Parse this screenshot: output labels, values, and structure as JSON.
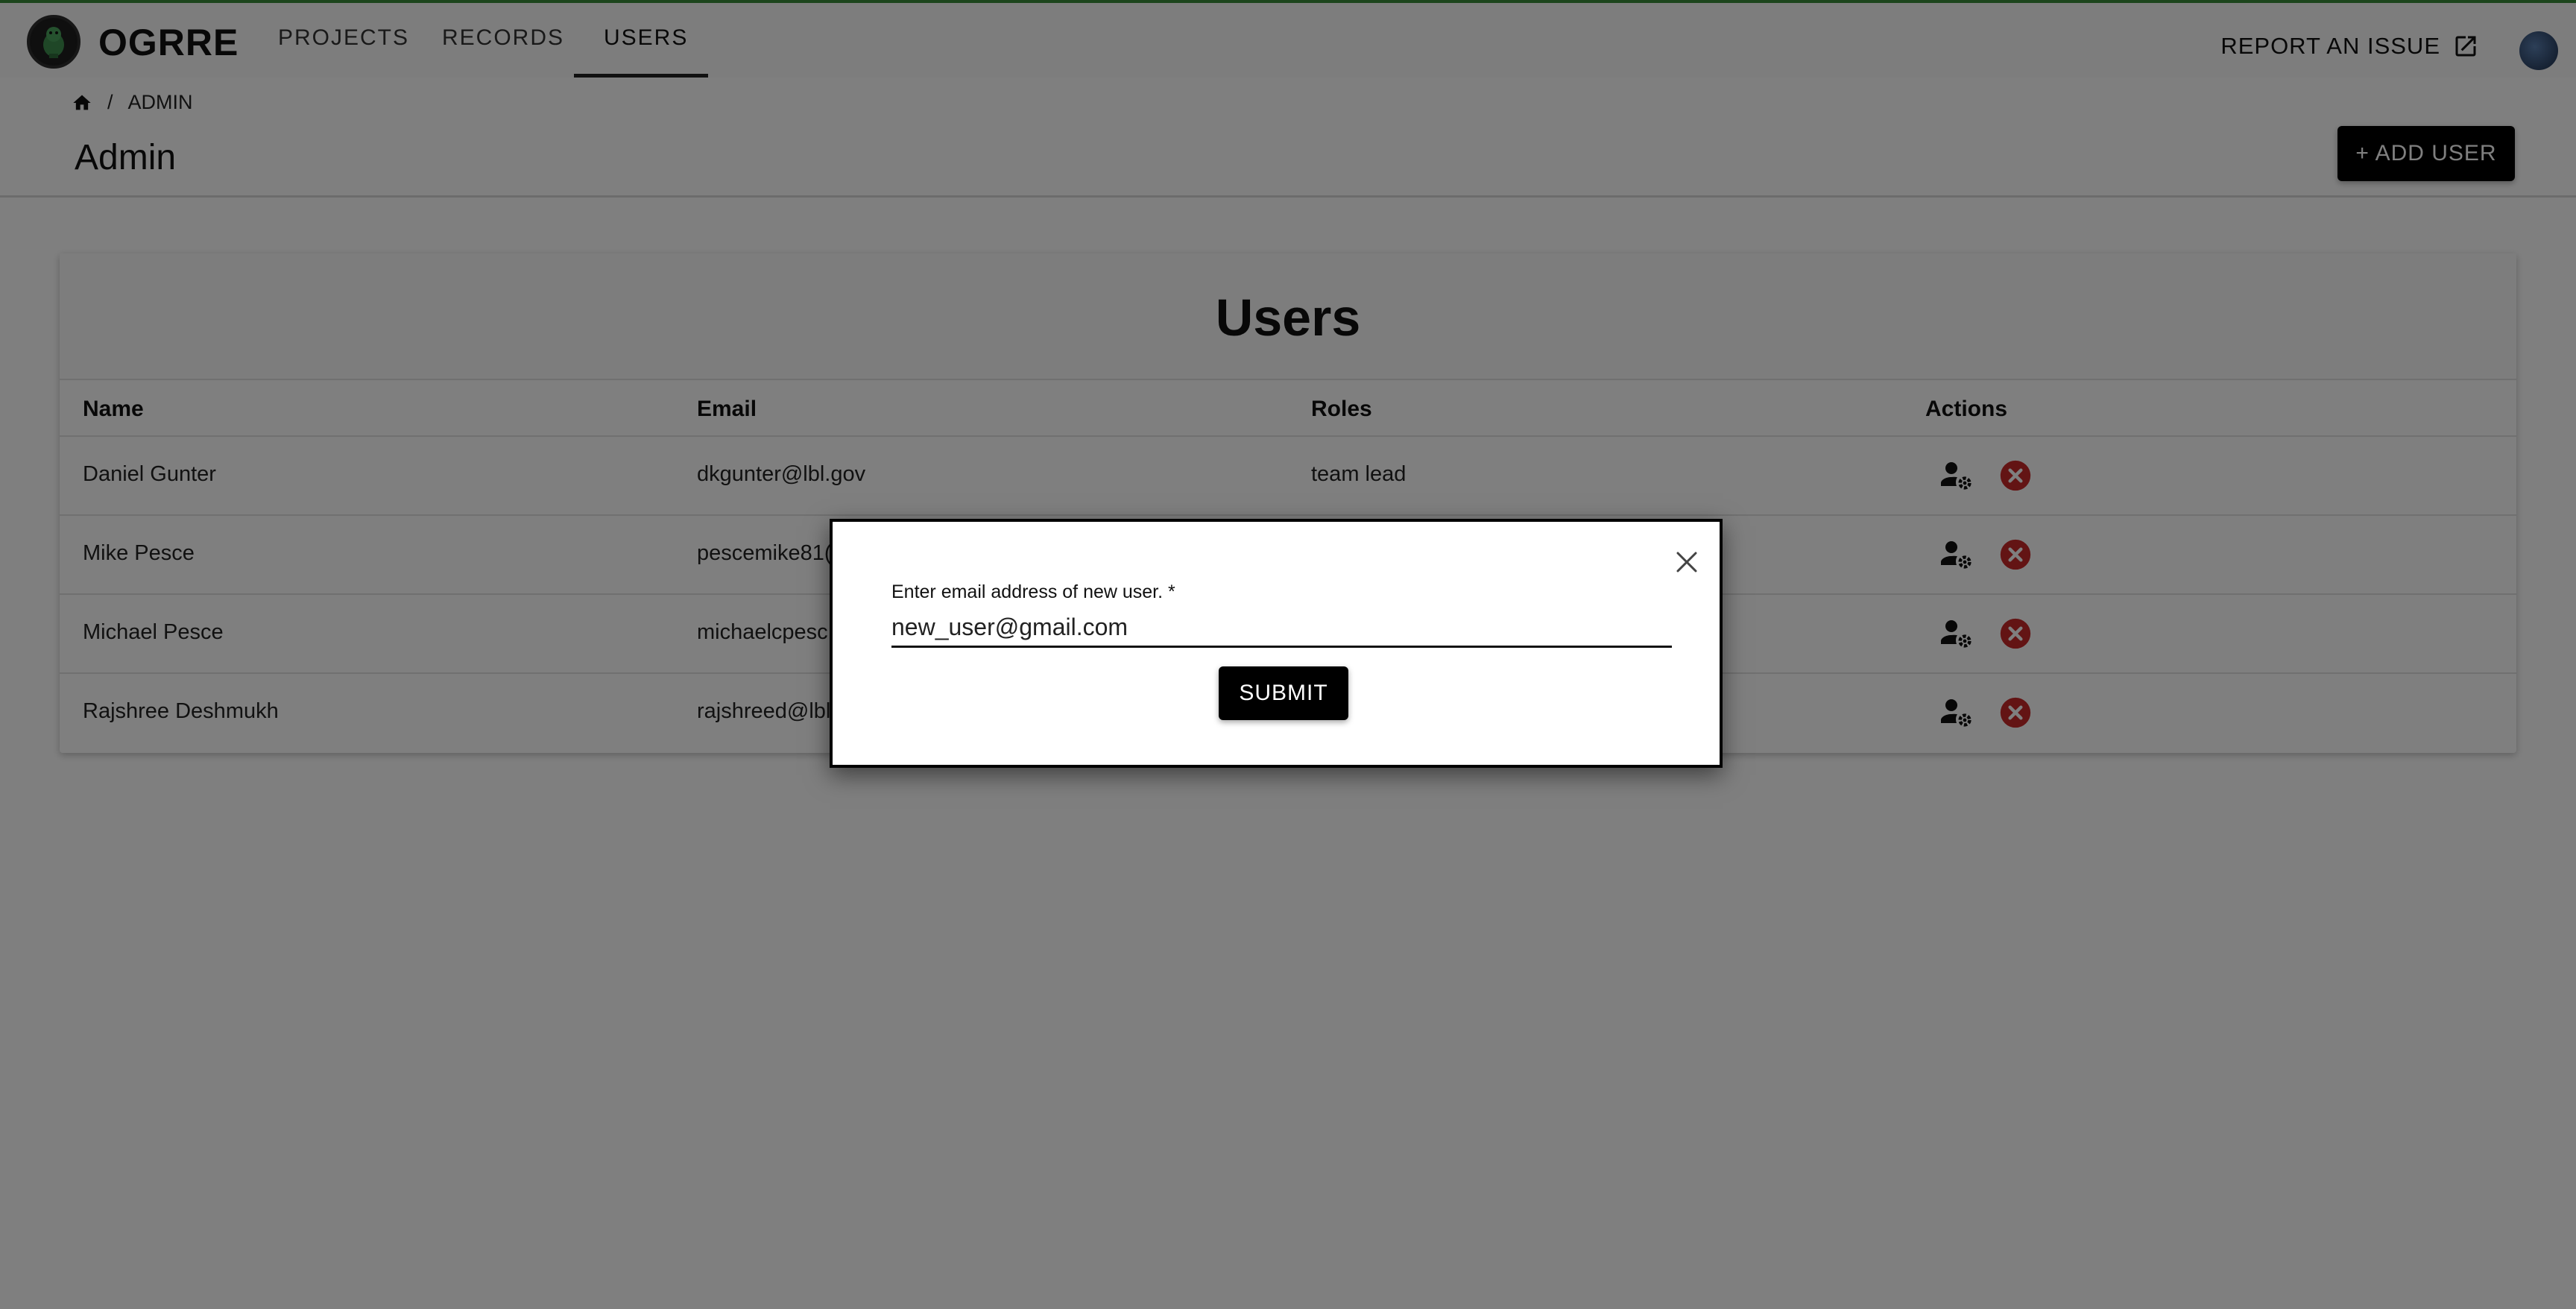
{
  "app": {
    "name": "OGRRE"
  },
  "nav": {
    "tabs": [
      {
        "label": "PROJECTS",
        "active": false
      },
      {
        "label": "RECORDS",
        "active": false
      },
      {
        "label": "USERS",
        "active": true
      }
    ],
    "report_label": "REPORT AN ISSUE"
  },
  "breadcrumb": {
    "separator": "/",
    "current": "ADMIN"
  },
  "page": {
    "title": "Admin",
    "add_user_label": "+ ADD USER"
  },
  "users_table": {
    "title": "Users",
    "columns": [
      "Name",
      "Email",
      "Roles",
      "Actions"
    ],
    "rows": [
      {
        "name": "Daniel Gunter",
        "email": "dkgunter@lbl.gov",
        "roles": "team lead"
      },
      {
        "name": "Mike Pesce",
        "email": "pescemike81(",
        "roles": ""
      },
      {
        "name": "Michael Pesce",
        "email": "michaelcpesc",
        "roles": ""
      },
      {
        "name": "Rajshree Deshmukh",
        "email": "rajshreed@lbl",
        "roles": ""
      }
    ]
  },
  "modal": {
    "field_label": "Enter email address of new user. *",
    "input_value": "new_user@gmail.com",
    "submit_label": "SUBMIT"
  },
  "colors": {
    "primary": "#000000",
    "delete": "#c62828",
    "top_accent": "#3b8a3b"
  }
}
